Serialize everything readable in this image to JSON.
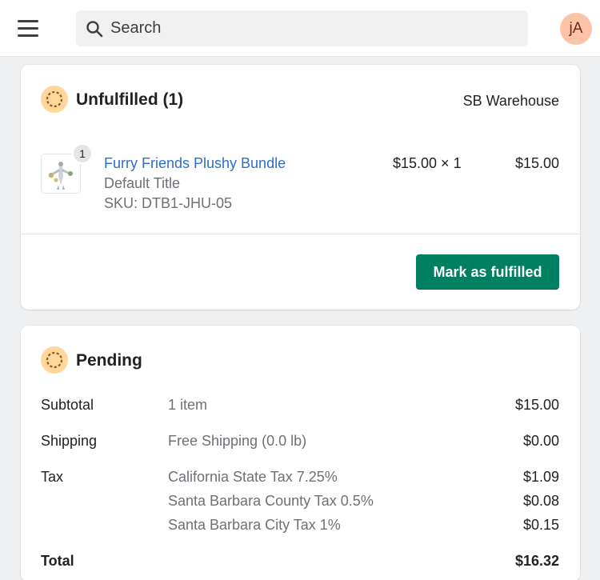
{
  "header": {
    "search_placeholder": "Search",
    "avatar_initials": "jA"
  },
  "fulfillment_card": {
    "status_title": "Unfulfilled (1)",
    "location": "SB Warehouse",
    "line_item": {
      "quantity_badge": "1",
      "product_name": "Furry Friends Plushy Bundle",
      "variant": "Default Title",
      "sku": "SKU: DTB1-JHU-05",
      "unit_price": "$15.00 × 1",
      "total": "$15.00"
    },
    "action_label": "Mark as fulfilled"
  },
  "payment_card": {
    "status_title": "Pending",
    "rows": [
      {
        "label": "Subtotal",
        "desc": "1 item",
        "value": "$15.00"
      },
      {
        "label": "Shipping",
        "desc": "Free Shipping (0.0 lb)",
        "value": "$0.00"
      },
      {
        "label": "Tax",
        "desc": "California State Tax 7.25%",
        "value": "$1.09"
      },
      {
        "label": "",
        "desc": "Santa Barbara County Tax 0.5%",
        "value": "$0.08"
      },
      {
        "label": "",
        "desc": "Santa Barbara City Tax 1%",
        "value": "$0.15"
      }
    ],
    "total_label": "Total",
    "total_value": "$16.32"
  },
  "colors": {
    "primary_button": "#008060",
    "link": "#2c6ecb",
    "status_icon_bg": "#ffd79d",
    "avatar_bg": "#fdc3a8"
  },
  "icons": [
    "menu-icon",
    "search-icon",
    "pending-status-icon",
    "product-thumbnail"
  ]
}
